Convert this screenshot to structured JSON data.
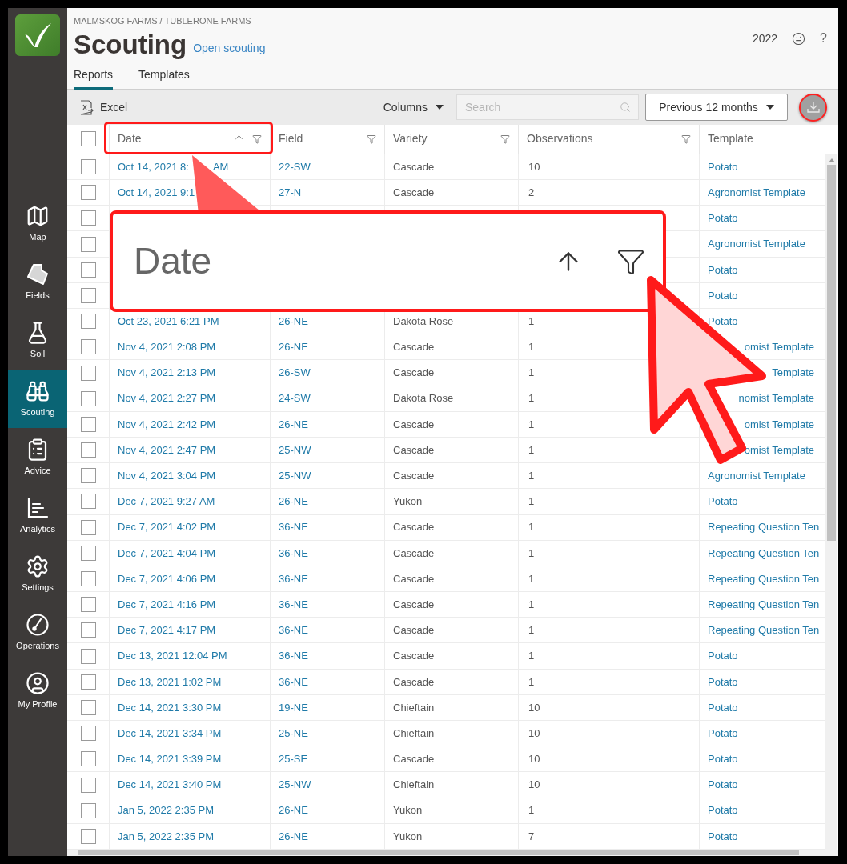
{
  "sidebar": {
    "items": [
      {
        "label": "Map",
        "selected": false
      },
      {
        "label": "Fields",
        "selected": false
      },
      {
        "label": "Soil",
        "selected": false
      },
      {
        "label": "Scouting",
        "selected": true
      },
      {
        "label": "Advice",
        "selected": false
      },
      {
        "label": "Analytics",
        "selected": false
      },
      {
        "label": "Settings",
        "selected": false
      },
      {
        "label": "Operations",
        "selected": false
      },
      {
        "label": "My Profile",
        "selected": false
      }
    ]
  },
  "header": {
    "breadcrumb": "MALMSKOG FARMS / TUBLERONE FARMS",
    "title": "Scouting",
    "link": "Open scouting",
    "year": "2022",
    "help": "?"
  },
  "tabs": [
    {
      "label": "Reports",
      "selected": true
    },
    {
      "label": "Templates",
      "selected": false
    }
  ],
  "toolbar": {
    "excel": "Excel",
    "columns": "Columns",
    "search": {
      "placeholder": "Search"
    },
    "range": "Previous 12 months"
  },
  "table": {
    "header_checked": false,
    "columns": [
      {
        "label": "Date",
        "sorted": true,
        "filter": true
      },
      {
        "label": "Field",
        "sorted": false,
        "filter": true
      },
      {
        "label": "Variety",
        "sorted": false,
        "filter": true
      },
      {
        "label": "Observations",
        "sorted": false,
        "filter": true
      },
      {
        "label": "Template",
        "sorted": false,
        "filter": false
      }
    ],
    "rows": [
      {
        "checked": false,
        "date": "Oct 14, 2021 8:",
        "date_end": "AM",
        "field": "22-SW",
        "variety": "Cascade",
        "observations": "10",
        "template": "Potato"
      },
      {
        "checked": false,
        "date": "Oct 14, 2021 9:1",
        "field": "27-N",
        "variety": "Cascade",
        "observations": "2",
        "template": "Agronomist Template"
      },
      {
        "checked": false,
        "template": "Potato"
      },
      {
        "checked": false,
        "template": "Agronomist Template"
      },
      {
        "checked": false,
        "template": "Potato"
      },
      {
        "checked": false,
        "template": "Potato"
      },
      {
        "checked": false,
        "date": "Oct 23, 2021 6:21 PM",
        "field": "26-NE",
        "variety": "Dakota Rose",
        "observations": "1",
        "template": "Potato"
      },
      {
        "checked": false,
        "date": "Nov 4, 2021 2:08 PM",
        "field": "26-NE",
        "variety": "Cascade",
        "observations": "1",
        "template": "omist Template",
        "clipped": true
      },
      {
        "checked": false,
        "date": "Nov 4, 2021 2:13 PM",
        "field": "26-SW",
        "variety": "Cascade",
        "observations": "1",
        "template": "Template",
        "clipped": true
      },
      {
        "checked": false,
        "date": "Nov 4, 2021 2:27 PM",
        "field": "24-SW",
        "variety": "Dakota Rose",
        "observations": "1",
        "template": "nomist Template",
        "clipped": true
      },
      {
        "checked": false,
        "date": "Nov 4, 2021 2:42 PM",
        "field": "26-NE",
        "variety": "Cascade",
        "observations": "1",
        "template": "omist Template",
        "clipped": true
      },
      {
        "checked": false,
        "date": "Nov 4, 2021 2:47 PM",
        "field": "25-NW",
        "variety": "Cascade",
        "observations": "1",
        "template": "omist Template",
        "clipped": true
      },
      {
        "checked": false,
        "date": "Nov 4, 2021 3:04 PM",
        "field": "25-NW",
        "variety": "Cascade",
        "observations": "1",
        "template": "Agronomist Template"
      },
      {
        "checked": false,
        "date": "Dec 7, 2021 9:27 AM",
        "field": "26-NE",
        "variety": "Yukon",
        "observations": "1",
        "template": "Potato"
      },
      {
        "checked": false,
        "date": "Dec 7, 2021 4:02 PM",
        "field": "36-NE",
        "variety": "Cascade",
        "observations": "1",
        "template": "Repeating Question Ten"
      },
      {
        "checked": false,
        "date": "Dec 7, 2021 4:04 PM",
        "field": "36-NE",
        "variety": "Cascade",
        "observations": "1",
        "template": "Repeating Question Ten"
      },
      {
        "checked": false,
        "date": "Dec 7, 2021 4:06 PM",
        "field": "36-NE",
        "variety": "Cascade",
        "observations": "1",
        "template": "Repeating Question Ten"
      },
      {
        "checked": false,
        "date": "Dec 7, 2021 4:16 PM",
        "field": "36-NE",
        "variety": "Cascade",
        "observations": "1",
        "template": "Repeating Question Ten"
      },
      {
        "checked": false,
        "date": "Dec 7, 2021 4:17 PM",
        "field": "36-NE",
        "variety": "Cascade",
        "observations": "1",
        "template": "Repeating Question Ten"
      },
      {
        "checked": false,
        "date": "Dec 13, 2021 12:04 PM",
        "field": "36-NE",
        "variety": "Cascade",
        "observations": "1",
        "template": "Potato"
      },
      {
        "checked": false,
        "date": "Dec 13, 2021 1:02 PM",
        "field": "36-NE",
        "variety": "Cascade",
        "observations": "1",
        "template": "Potato"
      },
      {
        "checked": false,
        "date": "Dec 14, 2021 3:30 PM",
        "field": "19-NE",
        "variety": "Chieftain",
        "observations": "10",
        "template": "Potato"
      },
      {
        "checked": false,
        "date": "Dec 14, 2021 3:34 PM",
        "field": "25-NE",
        "variety": "Chieftain",
        "observations": "10",
        "template": "Potato"
      },
      {
        "checked": false,
        "date": "Dec 14, 2021 3:39 PM",
        "field": "25-SE",
        "variety": "Cascade",
        "observations": "10",
        "template": "Potato"
      },
      {
        "checked": false,
        "date": "Dec 14, 2021 3:40 PM",
        "field": "25-NW",
        "variety": "Chieftain",
        "observations": "10",
        "template": "Potato"
      },
      {
        "checked": false,
        "date": "Jan 5, 2022 2:35 PM",
        "field": "26-NE",
        "variety": "Yukon",
        "observations": "1",
        "template": "Potato"
      },
      {
        "checked": false,
        "date": "Jan 5, 2022 2:35 PM",
        "field": "26-NE",
        "variety": "Yukon",
        "observations": "7",
        "template": "Potato"
      }
    ]
  },
  "callout": {
    "label": "Date",
    "sorted": true,
    "filter": true
  }
}
